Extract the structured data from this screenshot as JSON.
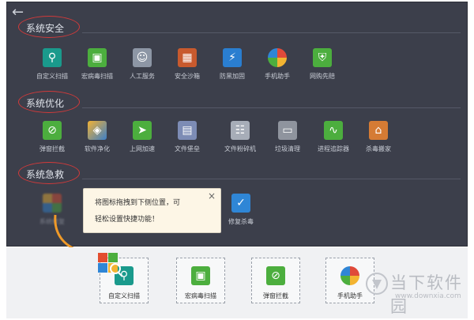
{
  "nav": {
    "back_icon": "arrow-left-icon"
  },
  "sections": [
    {
      "title": "系统安全",
      "tools": [
        {
          "label": "自定义扫描",
          "icon": "magnifier-icon",
          "color": "#1a9a8c"
        },
        {
          "label": "宏病毒扫描",
          "icon": "scan-icon",
          "color": "#4cae3e"
        },
        {
          "label": "人工服务",
          "icon": "person-icon",
          "color": "#8d96a5"
        },
        {
          "label": "安全沙箱",
          "icon": "sandbox-icon",
          "color": "#c85a2e"
        },
        {
          "label": "防黑加固",
          "icon": "lightning-icon",
          "color": "#2a7ed0"
        },
        {
          "label": "手机助手",
          "icon": "phone-assistant-icon",
          "color": "#e04a3a"
        },
        {
          "label": "网购先赔",
          "icon": "shield-icon",
          "color": "#4cae3e"
        }
      ]
    },
    {
      "title": "系统优化",
      "tools": [
        {
          "label": "弹窗拦截",
          "icon": "block-popup-icon",
          "color": "#4cae3e"
        },
        {
          "label": "软件净化",
          "icon": "layers-icon",
          "color": "#3d7fc8"
        },
        {
          "label": "上网加速",
          "icon": "rocket-icon",
          "color": "#4cae3e"
        },
        {
          "label": "文件堡垒",
          "icon": "file-vault-icon",
          "color": "#7d8cb5"
        },
        {
          "label": "文件粉碎机",
          "icon": "shredder-icon",
          "color": "#a7adb8"
        },
        {
          "label": "垃圾清理",
          "icon": "cleanup-icon",
          "color": "#8f949e"
        },
        {
          "label": "进程追踪器",
          "icon": "process-icon",
          "color": "#4cae3e"
        },
        {
          "label": "杀毒搬家",
          "icon": "house-icon",
          "color": "#d57b34"
        }
      ]
    },
    {
      "title": "系统急救",
      "tools": [
        {
          "label": "系统修复",
          "icon": "windows-icon",
          "color": "#e34d2f"
        },
        {
          "label": "修复杀毒",
          "icon": "repair-shield-icon",
          "color": "#2f86d6"
        }
      ]
    }
  ],
  "tooltip": {
    "line1": "将图标拖拽到下侧位置，可",
    "line2": "轻松设置快捷功能！",
    "close": "×"
  },
  "dock": {
    "slots": [
      {
        "label": "自定义扫描",
        "icon": "magnifier-icon",
        "color": "#1a9a8c"
      },
      {
        "label": "宏病毒扫描",
        "icon": "scan-icon",
        "color": "#4cae3e"
      },
      {
        "label": "弹窗拦截",
        "icon": "block-popup-icon",
        "color": "#4cae3e"
      },
      {
        "label": "手机助手",
        "icon": "phone-assistant-icon",
        "color": "#e04a3a"
      }
    ]
  },
  "watermark": {
    "name": "当下软件园",
    "url": "www.downxia.com"
  },
  "colors": {
    "panel_bg": "#3c3f4b",
    "dock_bg": "#f0f1f3",
    "circle": "#d23a3a",
    "arrow": "#f09a28"
  }
}
